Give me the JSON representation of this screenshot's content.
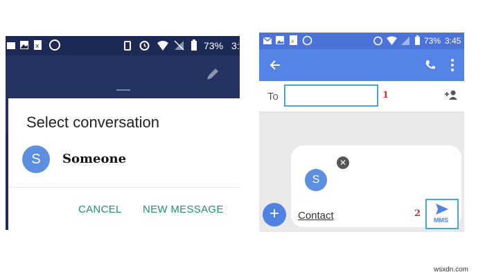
{
  "left": {
    "status": {
      "battery": "73%",
      "time": "3:"
    },
    "dialog": {
      "title": "Select conversation",
      "avatar_initial": "S",
      "contact_name": "Someone",
      "cancel_label": "CANCEL",
      "new_message_label": "NEW MESSAGE"
    }
  },
  "right": {
    "status": {
      "battery": "73%",
      "time": "3:45"
    },
    "to_label": "To",
    "step1_number": "1",
    "step2_number": "2",
    "avatar_initial": "S",
    "attachment_label": "Contact",
    "send_sublabel": "MMS"
  },
  "watermark": "wsxdn.com",
  "colors": {
    "left_bg": "#1f2c57",
    "accent_teal": "#1f8f7a",
    "right_bar": "#5384e6",
    "highlight": "#47a7d9",
    "step_red": "#c0392b"
  }
}
